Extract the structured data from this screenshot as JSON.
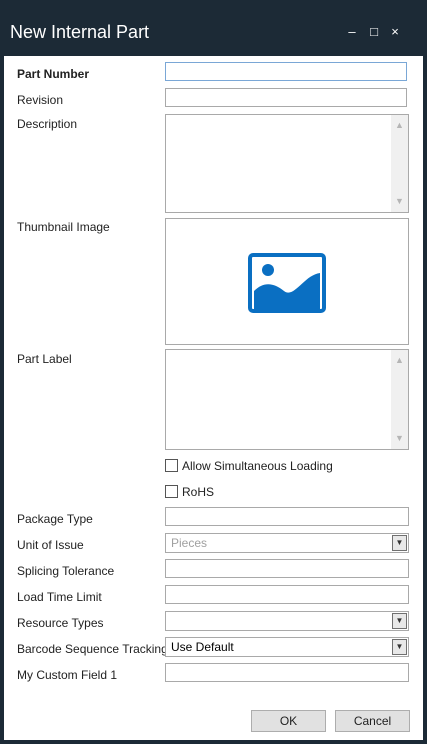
{
  "window": {
    "title": "New Internal Part",
    "controls": {
      "minimize": "–",
      "maximize": "□",
      "close": "×"
    }
  },
  "form": {
    "part_number": {
      "label": "Part Number",
      "value": ""
    },
    "revision": {
      "label": "Revision",
      "value": ""
    },
    "description": {
      "label": "Description",
      "value": ""
    },
    "thumbnail": {
      "label": "Thumbnail Image",
      "icon": "image-placeholder-icon",
      "icon_color": "#0a6fc2"
    },
    "part_label": {
      "label": "Part Label",
      "value": ""
    },
    "allow_simultaneous_loading": {
      "label": "Allow Simultaneous Loading",
      "checked": false
    },
    "rohs": {
      "label": "RoHS",
      "checked": false
    },
    "package_type": {
      "label": "Package Type",
      "value": ""
    },
    "unit_of_issue": {
      "label": "Unit of Issue",
      "value": "Pieces"
    },
    "splicing_tolerance": {
      "label": "Splicing Tolerance",
      "value": ""
    },
    "load_time_limit": {
      "label": "Load Time Limit",
      "value": ""
    },
    "resource_types": {
      "label": "Resource Types",
      "value": ""
    },
    "barcode_sequence_tracking": {
      "label": "Barcode Sequence Tracking",
      "value": "Use Default"
    },
    "custom_field_1": {
      "label": "My Custom Field 1",
      "value": ""
    }
  },
  "buttons": {
    "ok": "OK",
    "cancel": "Cancel"
  },
  "colors": {
    "title_bar": "#1c2a36",
    "accent": "#0a6fc2"
  }
}
